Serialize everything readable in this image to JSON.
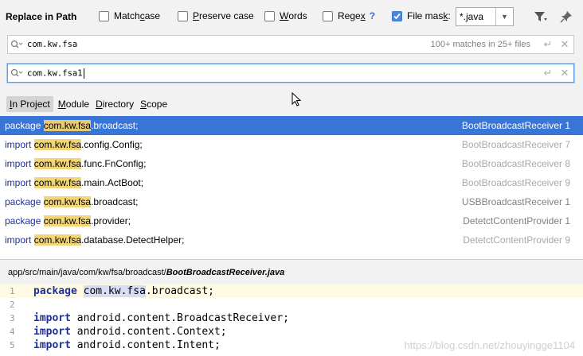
{
  "header": {
    "title": "Replace in Path",
    "options": [
      {
        "pre": "Match ",
        "u": "c",
        "post": "ase",
        "checked": false
      },
      {
        "pre": "",
        "u": "P",
        "post": "reserve case",
        "checked": false
      },
      {
        "pre": "",
        "u": "W",
        "post": "ords",
        "checked": false
      },
      {
        "pre": "Rege",
        "u": "x",
        "post": "",
        "checked": false,
        "help": "?"
      },
      {
        "pre": "File mas",
        "u": "k",
        "post": ":",
        "checked": true
      }
    ],
    "file_mask_value": "*.java",
    "icons": [
      "filter-icon",
      "pin-icon"
    ]
  },
  "find": {
    "value": "com.kw.fsa",
    "match_count": "100+ matches in 25+ files"
  },
  "replace": {
    "value": "com.kw.fsa1"
  },
  "scopes": [
    {
      "pre": "",
      "u": "I",
      "post": "n Project",
      "selected": true
    },
    {
      "pre": "",
      "u": "M",
      "post": "odule",
      "selected": false
    },
    {
      "pre": "",
      "u": "D",
      "post": "irectory",
      "selected": false
    },
    {
      "pre": "",
      "u": "S",
      "post": "cope",
      "selected": false
    }
  ],
  "results": [
    {
      "kw": "package",
      "match": "com.kw.fsa",
      "rest": ".broadcast;",
      "file": "BootBroadcastReceiver",
      "line": "1",
      "selected": true,
      "file_active": true
    },
    {
      "kw": "import",
      "match": "com.kw.fsa",
      "rest": ".config.Config;",
      "file": "BootBroadcastReceiver",
      "line": "7",
      "selected": false,
      "file_active": false
    },
    {
      "kw": "import",
      "match": "com.kw.fsa",
      "rest": ".func.FnConfig;",
      "file": "BootBroadcastReceiver",
      "line": "8",
      "selected": false,
      "file_active": false
    },
    {
      "kw": "import",
      "match": "com.kw.fsa",
      "rest": ".main.ActBoot;",
      "file": "BootBroadcastReceiver",
      "line": "9",
      "selected": false,
      "file_active": false
    },
    {
      "kw": "package",
      "match": "com.kw.fsa",
      "rest": ".broadcast;",
      "file": "USBBroadcastReceiver",
      "line": "1",
      "selected": false,
      "file_active": true
    },
    {
      "kw": "package",
      "match": "com.kw.fsa",
      "rest": ".provider;",
      "file": "DetetctContentProvider",
      "line": "1",
      "selected": false,
      "file_active": true
    },
    {
      "kw": "import",
      "match": "com.kw.fsa",
      "rest": ".database.DetectHelper;",
      "file": "DetetctContentProvider",
      "line": "9",
      "selected": false,
      "file_active": false
    }
  ],
  "path": {
    "dir": "app/src/main/java/com/kw/fsa/broadcast/",
    "file": "BootBroadcastReceiver.java"
  },
  "editor": {
    "lines": [
      {
        "n": "1",
        "kw": "package",
        "match": "com.kw.fsa",
        "rest": ".broadcast;",
        "current": true
      },
      {
        "n": "2",
        "kw": "",
        "match": "",
        "rest": "",
        "current": false
      },
      {
        "n": "3",
        "kw": "import",
        "match": "",
        "rest": "android.content.BroadcastReceiver;",
        "current": false
      },
      {
        "n": "4",
        "kw": "import",
        "match": "",
        "rest": "android.content.Context;",
        "current": false
      },
      {
        "n": "5",
        "kw": "import",
        "match": "",
        "rest": "android.content.Intent;",
        "current": false
      }
    ]
  },
  "watermark": "https://blog.csdn.net/zhouyingge1104"
}
